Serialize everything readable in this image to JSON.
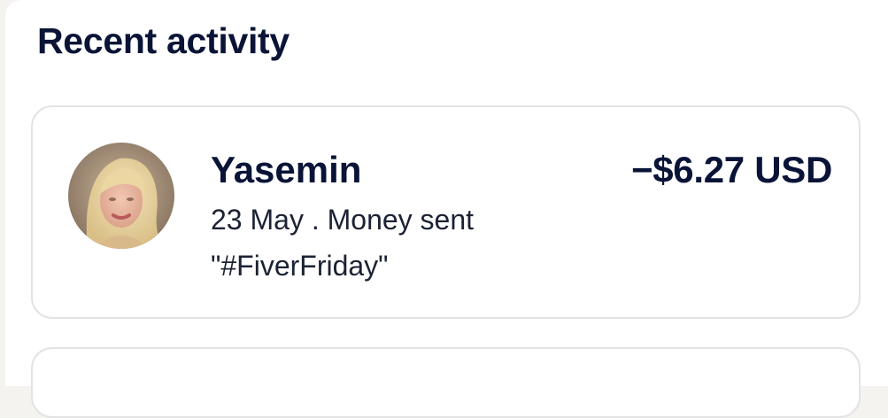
{
  "section": {
    "title": "Recent activity"
  },
  "activity": [
    {
      "name": "Yasemin",
      "date": "23 May",
      "separator": " . ",
      "type": "Money sent",
      "note": "\"#FiverFriday\"",
      "amount": "−$6.27 USD",
      "avatar_icon": "user-photo-avatar"
    }
  ],
  "colors": {
    "text_primary": "#0a1437",
    "text_secondary": "#1b2233",
    "card_border": "#e3e3e6",
    "background": "#f4f3ef"
  }
}
